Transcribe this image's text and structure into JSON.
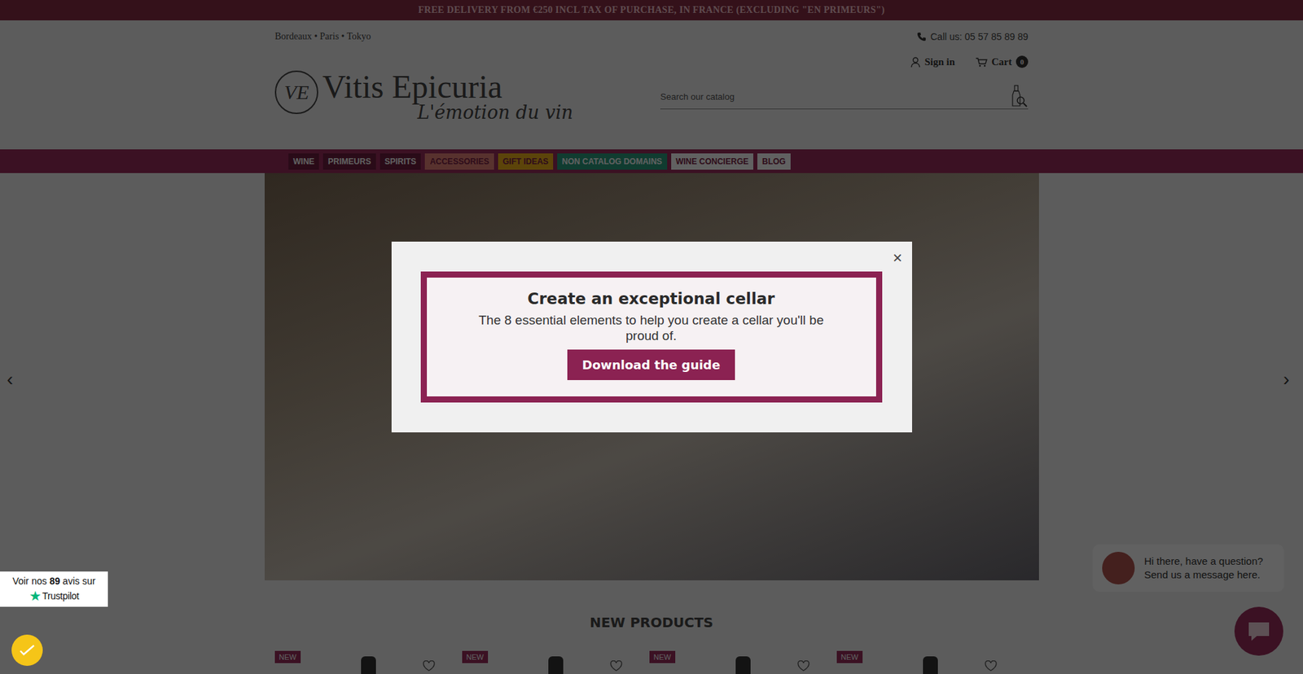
{
  "topbar": {
    "text": "FREE DELIVERY FROM €250 INCL TAX OF PURCHASE, IN FRANCE (EXCLUDING \"EN PRIMEURS\")"
  },
  "header": {
    "locations": "Bordeaux • Paris • Tokyo",
    "phone": "Call us: 05 57 85 89 89",
    "sign_in": "Sign in",
    "cart": "Cart",
    "cart_count": "0"
  },
  "logo": {
    "monogram": "VE",
    "name": "Vitis Epicuria",
    "tagline": "L'émotion du vin"
  },
  "search": {
    "placeholder": "Search our catalog"
  },
  "nav": [
    {
      "label": "WINE",
      "color": "#6f1f3f"
    },
    {
      "label": "PRIMEURS",
      "color": "#6f1f3f"
    },
    {
      "label": "SPIRITS",
      "color": "#6f1f3f"
    },
    {
      "label": "ACCESSORIES",
      "color": "#e8857a"
    },
    {
      "label": "GIFT IDEAS",
      "color": "#f2b21b"
    },
    {
      "label": "NON CATALOG DOMAINS",
      "color": "#2a9d7f"
    },
    {
      "label": "WINE CONCIERGE",
      "color": "#ffffff"
    },
    {
      "label": "BLOG",
      "color": "#ffffff"
    }
  ],
  "hero": {
    "prev": "‹",
    "next": "›"
  },
  "section": {
    "title": "NEW PRODUCTS"
  },
  "products": [
    {
      "badge": "NEW"
    },
    {
      "badge": "NEW"
    },
    {
      "badge": "NEW"
    },
    {
      "badge": "NEW"
    }
  ],
  "modal": {
    "close": "×",
    "title": "Create an exceptional cellar",
    "text": "The 8 essential elements to help you create a cellar you'll be proud of.",
    "button": "Download the guide"
  },
  "trustpilot": {
    "prefix": "Voir nos",
    "count": "89",
    "suffix": "avis sur",
    "star": "★",
    "brand": "Trustpilot"
  },
  "chat": {
    "lines": [
      "Hi there, have a question?",
      "Send us a message here."
    ]
  }
}
